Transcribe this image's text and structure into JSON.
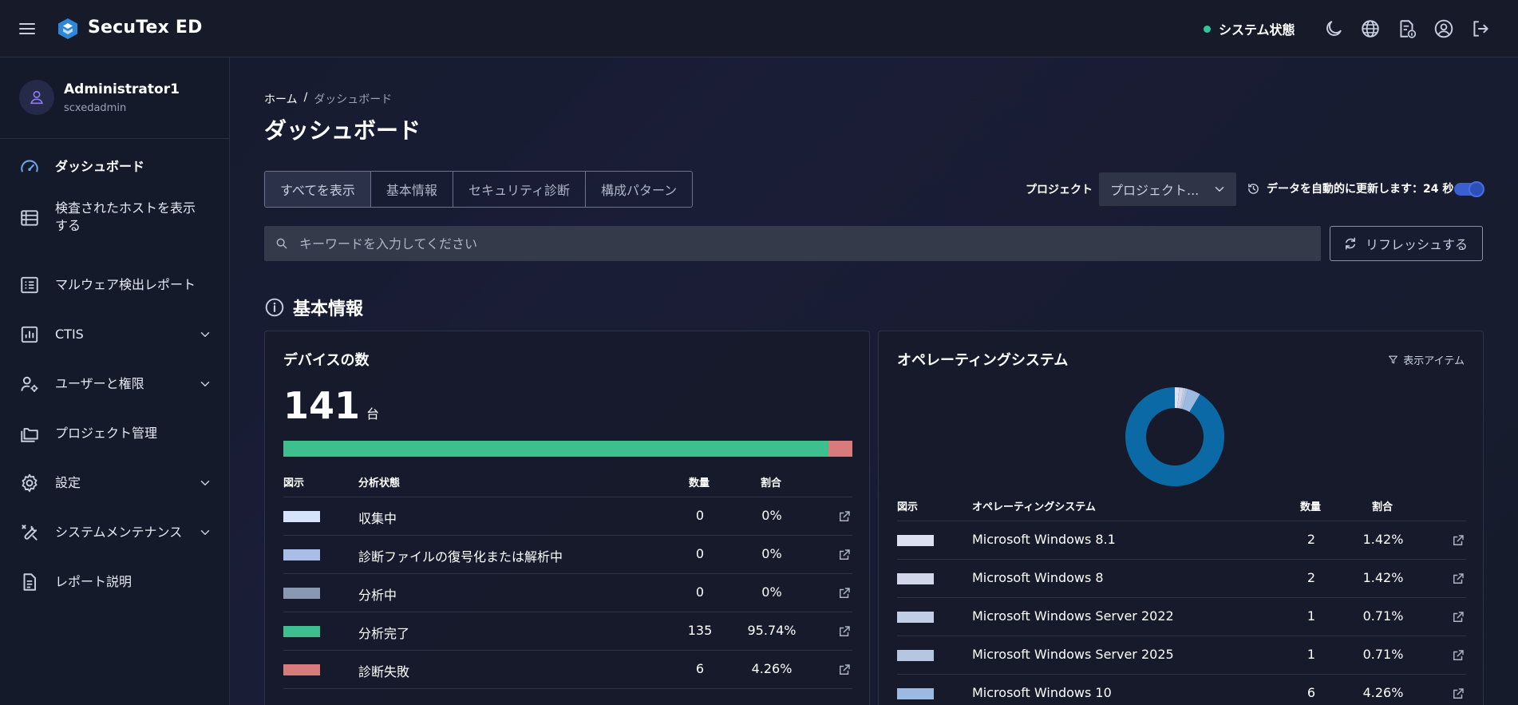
{
  "header": {
    "brand": "SecuTex ED",
    "system_status": "システム状態"
  },
  "user": {
    "name": "Administrator1",
    "id": "scxedadmin"
  },
  "nav": [
    {
      "label": "ダッシュボード",
      "active": true
    },
    {
      "label": "検査されたホストを表示する"
    },
    {
      "label": "マルウェア検出レポート"
    },
    {
      "label": "CTIS"
    },
    {
      "label": "ユーザーと権限"
    },
    {
      "label": "プロジェクト管理"
    },
    {
      "label": "設定"
    },
    {
      "label": "システムメンテナンス"
    },
    {
      "label": "レポート説明"
    }
  ],
  "breadcrumb": {
    "home": "ホーム",
    "separator": "/",
    "current": "ダッシュボード"
  },
  "page_title": "ダッシュボード",
  "tabs": [
    "すべてを表示",
    "基本情報",
    "セキュリティ診断",
    "構成パターン"
  ],
  "project": {
    "label": "プロジェクト",
    "selected": "プロジェクト..."
  },
  "auto_refresh": {
    "label": "データを自動的に更新します：24 秒",
    "enabled": true
  },
  "search": {
    "placeholder": "キーワードを入力してください",
    "value": ""
  },
  "refresh_button": "リフレッシュする",
  "section": {
    "title": "基本情報"
  },
  "devices": {
    "title": "デバイスの数",
    "count": "141",
    "unit": "台",
    "headers": {
      "legend": "図示",
      "status": "分析状態",
      "qty": "数量",
      "ratio": "割合"
    },
    "rows": [
      {
        "status": "収集中",
        "qty": "0",
        "ratio": "0%",
        "color": "#d7e3fb",
        "pct": 0
      },
      {
        "status": "診断ファイルの復号化または解析中",
        "qty": "0",
        "ratio": "0%",
        "color": "#a9bde6",
        "pct": 0
      },
      {
        "status": "分析中",
        "qty": "0",
        "ratio": "0%",
        "color": "#8a98b2",
        "pct": 0
      },
      {
        "status": "分析完了",
        "qty": "135",
        "ratio": "95.74%",
        "color": "#3dbf8e",
        "pct": 95.74
      },
      {
        "status": "診断失敗",
        "qty": "6",
        "ratio": "4.26%",
        "color": "#d97a7c",
        "pct": 4.26
      }
    ]
  },
  "os": {
    "title": "オペレーティングシステム",
    "filter_label": "表示アイテム",
    "headers": {
      "legend": "図示",
      "name": "オペレーティングシステム",
      "qty": "数量",
      "ratio": "割合"
    },
    "rows": [
      {
        "name": "Microsoft Windows 8.1",
        "qty": "2",
        "ratio": "1.42%",
        "color": "#dedff0",
        "pct": 1.42
      },
      {
        "name": "Microsoft Windows 8",
        "qty": "2",
        "ratio": "1.42%",
        "color": "#d2d6ea",
        "pct": 1.42
      },
      {
        "name": "Microsoft Windows Server 2022",
        "qty": "1",
        "ratio": "0.71%",
        "color": "#c2cde6",
        "pct": 0.71
      },
      {
        "name": "Microsoft Windows Server 2025",
        "qty": "1",
        "ratio": "0.71%",
        "color": "#b4c6e2",
        "pct": 0.71
      },
      {
        "name": "Microsoft Windows 10",
        "qty": "6",
        "ratio": "4.26%",
        "color": "#9cb9df",
        "pct": 4.26
      }
    ],
    "other_color": "#0b69a6"
  }
}
